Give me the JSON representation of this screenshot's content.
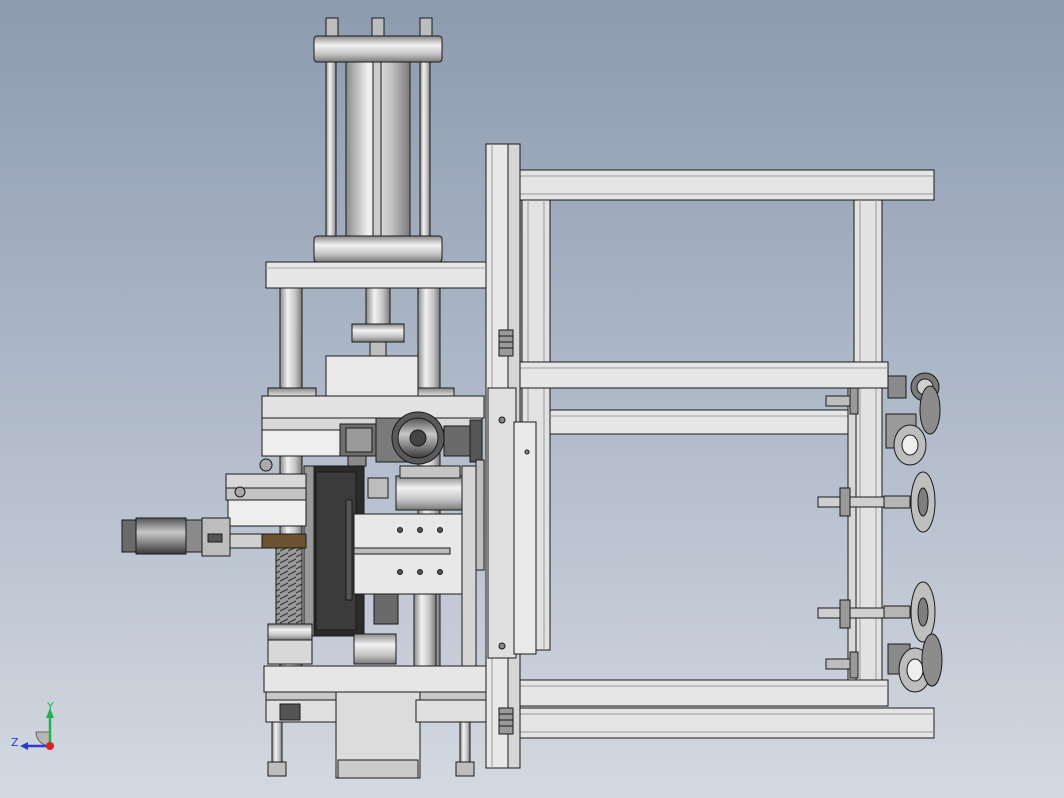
{
  "triad": {
    "y_label": "Y",
    "z_label": "Z",
    "y_color": "#22b14c",
    "z_color": "#2a3bd6",
    "x_color": "#e02020"
  },
  "colors": {
    "bg_top": "#8d9bb0",
    "bg_bottom": "#d4d9e1",
    "metal_light": "#e6e6e6",
    "metal_mid": "#b8b8b8",
    "metal_dark": "#6e6e6e",
    "dark_part": "#2b2b2b",
    "bronze": "#6b5230",
    "outline": "#1a1a1a"
  }
}
